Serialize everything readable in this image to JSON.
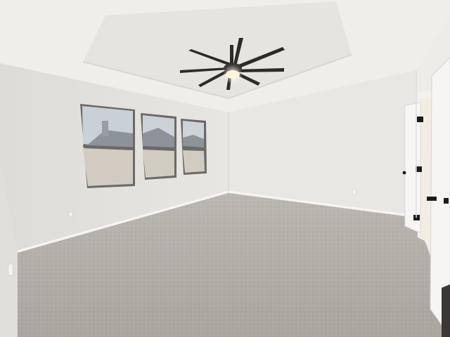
{
  "scene": {
    "subject": "empty-bedroom",
    "colors": {
      "ceiling": "#efeeeb",
      "tray_ceiling": "#e6e5e1",
      "wall_left": "#e4e2de",
      "wall_back": "#e9e7e3",
      "wall_right": "#eeece9",
      "carpet": "#b3aea8",
      "fan_dark": "#2d2a28",
      "fan_light": "#fff6de",
      "window_frame": "#6c6a66",
      "sky": "#c9d0d6",
      "fence": "#cfc9c0",
      "door": "#f7f6f4",
      "door_hardware": "#1c1b1a",
      "baseboard": "#f5f4f1"
    }
  }
}
